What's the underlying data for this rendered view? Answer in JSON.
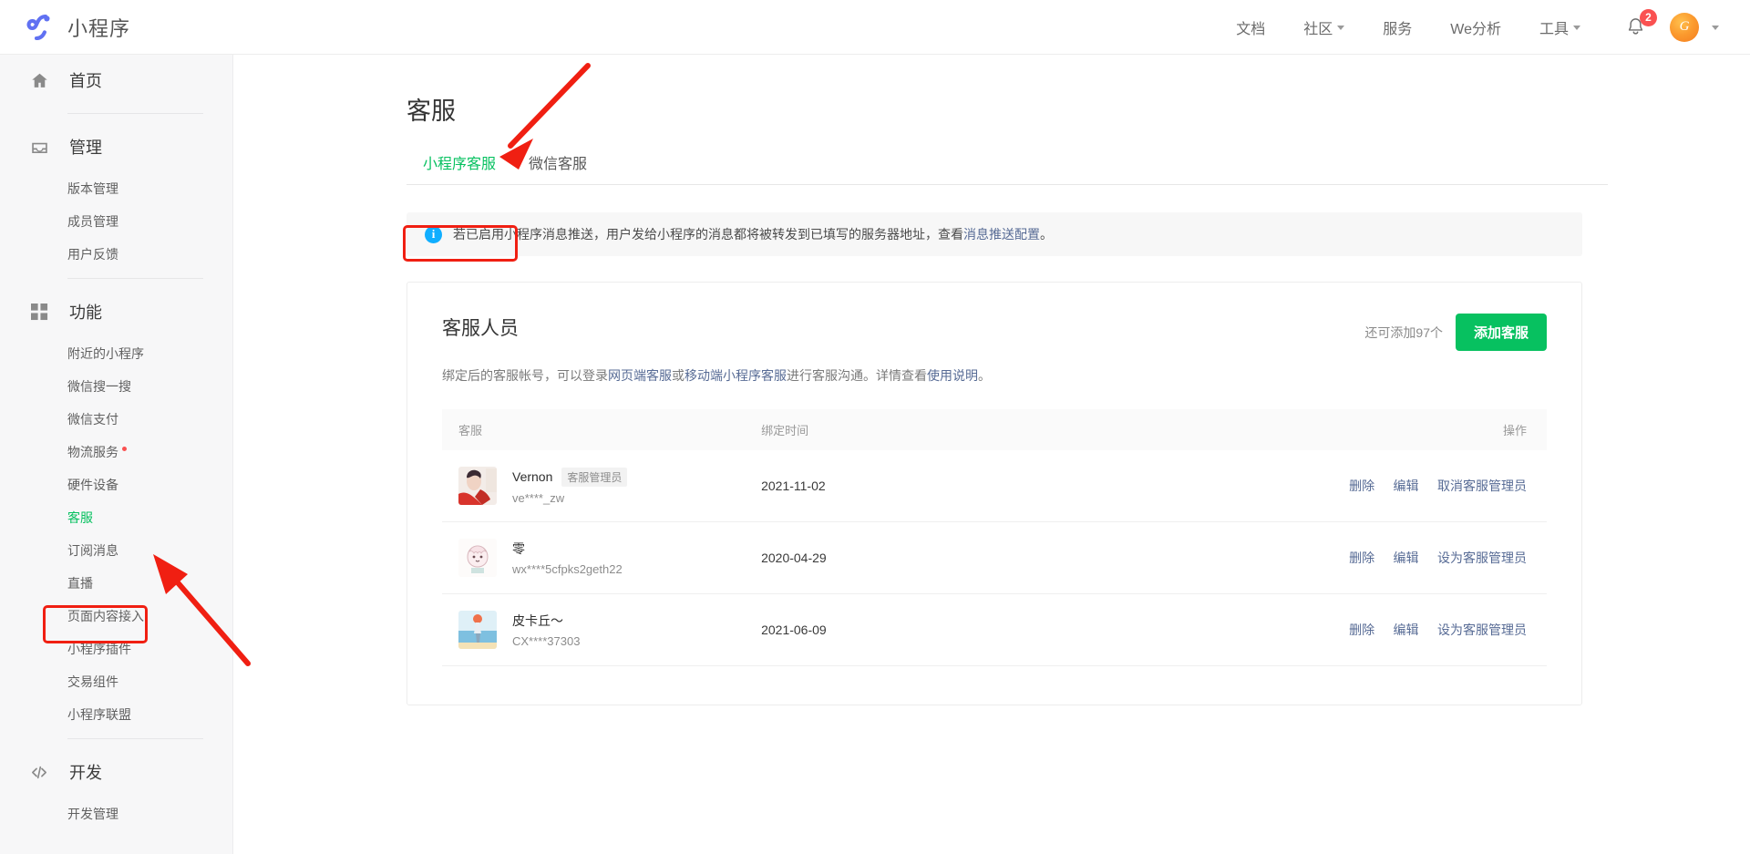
{
  "topbar": {
    "brand": "小程序",
    "logo_icon": "miniprogram-logo-icon",
    "nav": [
      {
        "label": "文档",
        "has_caret": false
      },
      {
        "label": "社区",
        "has_caret": true
      },
      {
        "label": "服务",
        "has_caret": false
      },
      {
        "label": "We分析",
        "has_caret": false
      },
      {
        "label": "工具",
        "has_caret": true
      }
    ],
    "bell_icon": "bell-icon",
    "notification_count": "2",
    "avatar_initial": "G",
    "account_caret_icon": "chevron-down-icon"
  },
  "sidebar": {
    "groups": [
      {
        "label": "首页",
        "icon": "home-icon",
        "items": []
      },
      {
        "label": "管理",
        "icon": "inbox-icon",
        "items": [
          {
            "label": "版本管理",
            "active": false,
            "dot": false
          },
          {
            "label": "成员管理",
            "active": false,
            "dot": false
          },
          {
            "label": "用户反馈",
            "active": false,
            "dot": false
          }
        ]
      },
      {
        "label": "功能",
        "icon": "grid-icon",
        "items": [
          {
            "label": "附近的小程序",
            "active": false,
            "dot": false
          },
          {
            "label": "微信搜一搜",
            "active": false,
            "dot": false
          },
          {
            "label": "微信支付",
            "active": false,
            "dot": false
          },
          {
            "label": "物流服务",
            "active": false,
            "dot": true
          },
          {
            "label": "硬件设备",
            "active": false,
            "dot": false
          },
          {
            "label": "客服",
            "active": true,
            "dot": false
          },
          {
            "label": "订阅消息",
            "active": false,
            "dot": false
          },
          {
            "label": "直播",
            "active": false,
            "dot": false
          },
          {
            "label": "页面内容接入",
            "active": false,
            "dot": false
          },
          {
            "label": "小程序插件",
            "active": false,
            "dot": false
          },
          {
            "label": "交易组件",
            "active": false,
            "dot": false
          },
          {
            "label": "小程序联盟",
            "active": false,
            "dot": false
          }
        ]
      },
      {
        "label": "开发",
        "icon": "code-icon",
        "items": [
          {
            "label": "开发管理",
            "active": false,
            "dot": false
          }
        ]
      }
    ]
  },
  "main": {
    "page_title": "客服",
    "tabs": [
      {
        "label": "小程序客服",
        "active": true
      },
      {
        "label": "微信客服",
        "active": false
      }
    ],
    "notice": {
      "icon": "info-icon",
      "text_before": "若已启用小程序消息推送，用户发给小程序的消息都将被转发到已填写的服务器地址，查看 ",
      "link": "消息推送配置",
      "text_after": "。"
    },
    "card": {
      "title": "客服人员",
      "quota": "还可添加97个",
      "add_button": "添加客服",
      "desc_1": "绑定后的客服帐号，可以登录",
      "desc_link_1": "网页端客服",
      "desc_2": "或",
      "desc_link_2": "移动端小程序客服",
      "desc_3": "进行客服沟通。详情查看",
      "desc_link_3": "使用说明",
      "desc_4": "。",
      "columns": [
        "客服",
        "绑定时间",
        "操作"
      ],
      "rows": [
        {
          "avatar": "avatar-vernon",
          "name": "Vernon",
          "tag": "客服管理员",
          "uid": "ve****_zw",
          "time": "2021-11-02",
          "actions": [
            "删除",
            "编辑",
            "取消客服管理员"
          ]
        },
        {
          "avatar": "avatar-ling",
          "name": "零",
          "tag": "",
          "uid": "wx****5cfpks2geth22",
          "time": "2020-04-29",
          "actions": [
            "删除",
            "编辑",
            "设为客服管理员"
          ]
        },
        {
          "avatar": "avatar-pikachu",
          "name": "皮卡丘～",
          "tag": "",
          "uid": "CX****37303",
          "time": "2021-06-09",
          "actions": [
            "删除",
            "编辑",
            "设为客服管理员"
          ]
        }
      ]
    }
  },
  "annotations": {
    "highlight_color": "#f01f12",
    "marks": [
      {
        "name": "tab-highlight-box",
        "target": "小程序客服"
      },
      {
        "name": "sidebar-highlight-box",
        "target": "客服"
      }
    ]
  }
}
